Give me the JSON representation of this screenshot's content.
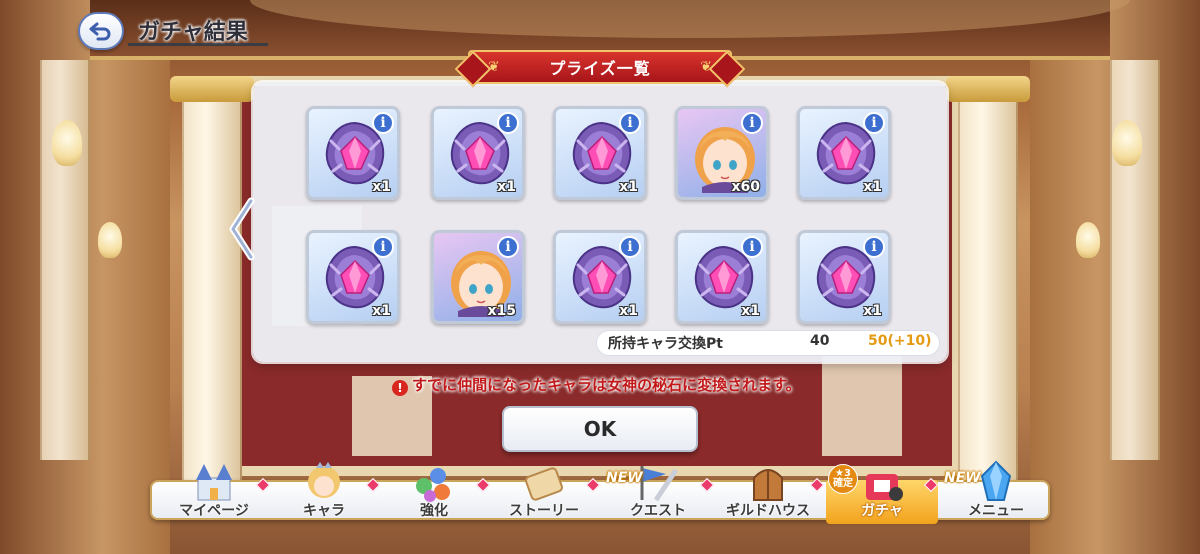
{
  "header": {
    "title": "ガチャ結果"
  },
  "panel": {
    "ribbon_title": "プライズ一覧"
  },
  "results": [
    {
      "type": "stone",
      "qty": "x1"
    },
    {
      "type": "stone",
      "qty": "x1"
    },
    {
      "type": "stone",
      "qty": "x1"
    },
    {
      "type": "chara",
      "qty": "x60"
    },
    {
      "type": "stone",
      "qty": "x1"
    },
    {
      "type": "stone",
      "qty": "x1"
    },
    {
      "type": "chara",
      "qty": "x15"
    },
    {
      "type": "stone",
      "qty": "x1"
    },
    {
      "type": "stone",
      "qty": "x1"
    },
    {
      "type": "stone",
      "qty": "x1"
    }
  ],
  "info_glyph": "i",
  "exchange": {
    "label": "所持キャラ交換Pt",
    "current": "40",
    "after": "50(+10)"
  },
  "notice": {
    "icon": "!",
    "text": "すでに仲間になったキャラは女神の秘石に変換されます。"
  },
  "ok_button": {
    "label": "OK"
  },
  "bottom_nav": {
    "items": [
      {
        "label": "マイページ",
        "icon": "castle-icon"
      },
      {
        "label": "キャラ",
        "icon": "character-icon"
      },
      {
        "label": "強化",
        "icon": "gems-icon"
      },
      {
        "label": "ストーリー",
        "icon": "scroll-icon"
      },
      {
        "label": "クエスト",
        "icon": "sword-flag-icon",
        "badge": "NEW"
      },
      {
        "label": "ギルドハウス",
        "icon": "guild-door-icon"
      },
      {
        "label": "ガチャ",
        "icon": "gacha-icon",
        "active": true
      },
      {
        "label": "メニュー",
        "icon": "crystal-icon",
        "badge": "NEW"
      }
    ],
    "gacha_confirm": {
      "star": "★3",
      "text": "確定"
    }
  },
  "colors": {
    "ribbon": "#c3201f",
    "info_badge": "#3c6fcf",
    "notice_red": "#c21a1a",
    "points_orange": "#e49b13",
    "active_tab": "#f2a31d"
  }
}
